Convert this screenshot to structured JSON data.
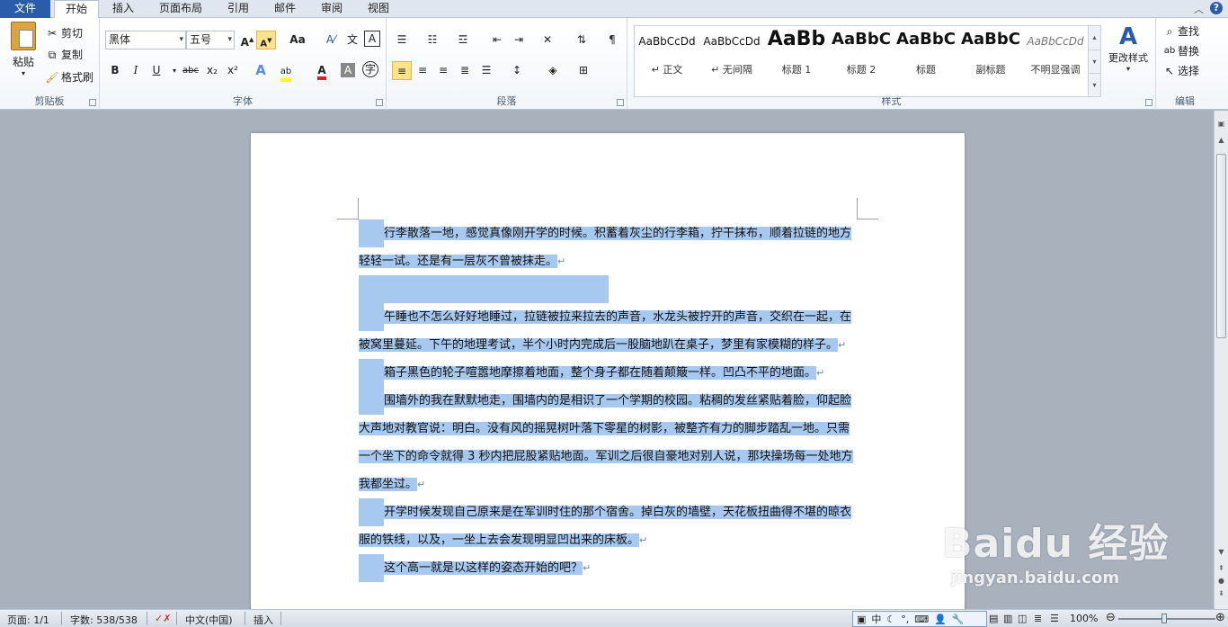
{
  "tabs": {
    "file": "文件",
    "home": "开始",
    "insert": "插入",
    "layout": "页面布局",
    "references": "引用",
    "mailings": "邮件",
    "review": "审阅",
    "view": "视图"
  },
  "clipboard": {
    "paste": "粘贴",
    "cut": "剪切",
    "copy": "复制",
    "format_painter": "格式刷",
    "label": "剪贴板"
  },
  "font": {
    "family": "黑体",
    "size": "五号",
    "label": "字体",
    "bold": "B",
    "italic": "I",
    "underline": "U",
    "strike": "abc",
    "subscript": "x₂",
    "superscript": "x²",
    "grow": "A",
    "shrink": "A",
    "case": "Aa"
  },
  "paragraph": {
    "label": "段落"
  },
  "styles": {
    "label": "样式",
    "items": [
      {
        "sample": "AaBbCcDd",
        "name": "↵ 正文"
      },
      {
        "sample": "AaBbCcDd",
        "name": "↵ 无间隔"
      },
      {
        "sample": "AaBb",
        "name": "标题 1"
      },
      {
        "sample": "AaBbC",
        "name": "标题 2"
      },
      {
        "sample": "AaBbC",
        "name": "标题"
      },
      {
        "sample": "AaBbC",
        "name": "副标题"
      },
      {
        "sample": "AaBbCcDd",
        "name": "不明显强调"
      }
    ],
    "change_styles": "更改样式"
  },
  "editing": {
    "label": "编辑",
    "find": "查找",
    "replace": "替换",
    "select": "选择"
  },
  "document": {
    "paragraphs": [
      "行李散落一地，感觉真像刚开学的时候。积蓄着灰尘的行李箱，拧干抹布，顺着拉链的地方轻轻一试。还是有一层灰不曾被抹走。",
      "",
      "午睡也不怎么好好地睡过，拉链被拉来拉去的声音，水龙头被拧开的声音，交织在一起，在被窝里蔓延。下午的地理考试，半个小时内完成后一股脑地趴在桌子，梦里有家模糊的样子。",
      "箱子黑色的轮子喧嚣地摩擦着地面，整个身子都在随着颠簸一样。凹凸不平的地面。",
      "围墙外的我在默默地走，围墙内的是相识了一个学期的校园。粘稠的发丝紧贴着脸，仰起脸大声地对教官说：明白。没有风的摇晃树叶落下零星的树影，被整齐有力的脚步踏乱一地。只需一个坐下的命令就得 3 秒内把屁股紧贴地面。军训之后很自豪地对别人说，那块操场每一处地方我都坐过。",
      "开学时候发现自己原来是在军训时住的那个宿舍。掉白灰的墙壁，天花板扭曲得不堪的晾衣服的铁线，以及，一坐上去会发现明显凹出来的床板。",
      "这个高一就是以这样的姿态开始的吧？"
    ],
    "para_mark": "↵"
  },
  "status": {
    "page": "页面: 1/1",
    "words": "字数: 538/538",
    "language": "中文(中国)",
    "mode": "插入",
    "zoom": "100%"
  },
  "ime": {
    "lang": "中"
  },
  "watermark": {
    "main": "Baidu 经验",
    "url": "jingyan.baidu.com"
  },
  "colors": {
    "selection": "#a7c8ef",
    "file_tab": "#2a5cab",
    "highlight_yellow": "#ffff00",
    "font_red": "#e02020"
  }
}
